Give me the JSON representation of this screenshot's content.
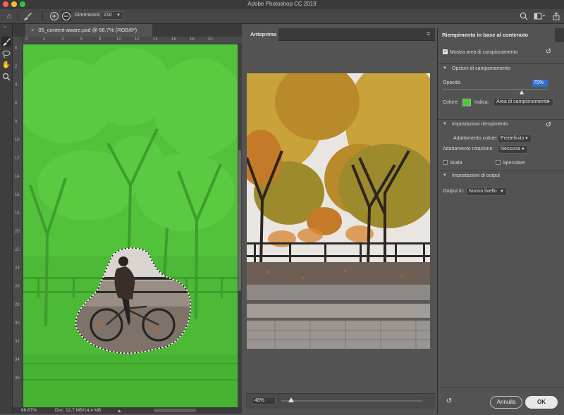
{
  "app": {
    "title": "Adobe Photoshop CC 2019"
  },
  "colors": {
    "accent_green": "#4ec93a",
    "traffic_close": "#fd5f57",
    "traffic_min": "#febc2e",
    "traffic_max": "#28c840"
  },
  "options_bar": {
    "home_icon": "home-icon",
    "brush_icon": "brush-icon",
    "add_icon": "plus-circle-icon",
    "subtract_icon": "minus-circle-icon",
    "size_label": "Dimensioni:",
    "size_value": "210",
    "search_icon": "search-icon",
    "workspace_icon": "workspace-icon",
    "share_icon": "share-icon"
  },
  "document": {
    "tab_title": "05_content-aware.psd @ 66,7% (RGB/8*)",
    "close_glyph": "×",
    "zoom_status": "66,67%",
    "doc_size": "Doc: 12,7 MB/14,4 MB",
    "ruler_top": [
      "0",
      "2",
      "4",
      "6",
      "8",
      "10",
      "12",
      "14",
      "16",
      "18",
      "20"
    ],
    "ruler_left": [
      "0",
      "2",
      "4",
      "6",
      "8",
      "10",
      "12",
      "14",
      "16",
      "18",
      "20",
      "22",
      "24",
      "26",
      "28",
      "30",
      "32",
      "34",
      "36"
    ]
  },
  "preview": {
    "tab_label": "Anteprima",
    "zoom_value": "48%",
    "zoom_fraction": 0.07
  },
  "panel": {
    "tab_label": "Riempimento in base al contenuto",
    "show_sampling": {
      "label": "Mostra area di campionamento",
      "checked": true
    },
    "sampling_options": {
      "title": "Opzioni di campionamento",
      "opacity_label": "Opacità:",
      "opacity_value": "75%",
      "opacity_fraction": 0.75,
      "color_label": "Colore:",
      "color_value": "#4ec93a",
      "indicates_label": "Indica:",
      "indicates_value": "Area di campionamento"
    },
    "fill_settings": {
      "title": "Impostazioni riempimento",
      "color_adapt_label": "Adattamento colore:",
      "color_adapt_value": "Predefinito",
      "rotation_adapt_label": "Adattamento rotazione:",
      "rotation_adapt_value": "Nessuna",
      "scale_label": "Scala",
      "scale_checked": false,
      "mirror_label": "Speculare",
      "mirror_checked": false
    },
    "output_settings": {
      "title": "Impostazioni di output",
      "output_label": "Output in:",
      "output_value": "Nuovo livello"
    },
    "cancel_label": "Annulla",
    "ok_label": "OK"
  }
}
